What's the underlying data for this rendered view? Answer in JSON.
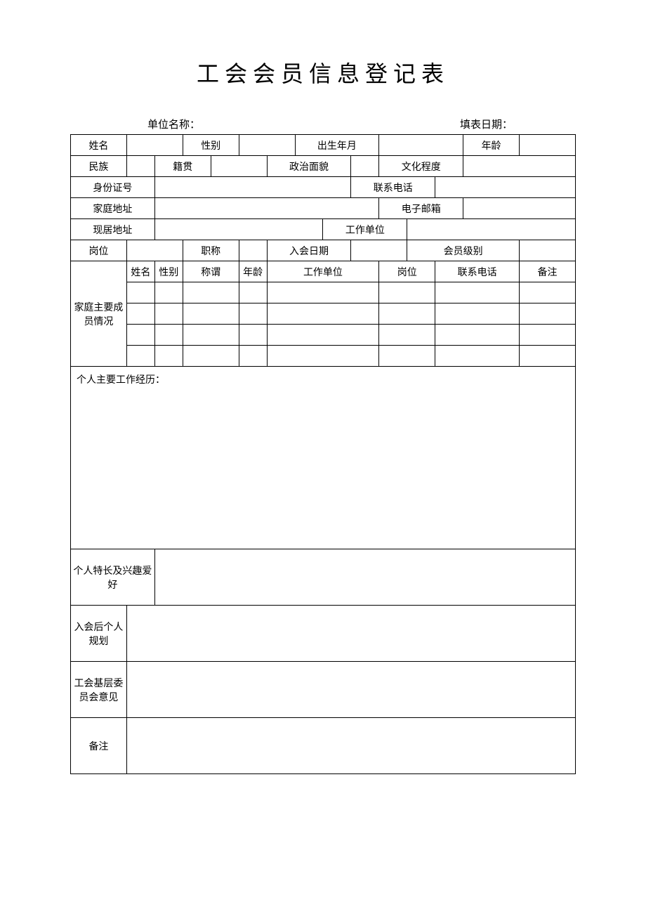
{
  "title": "工会会员信息登记表",
  "header": {
    "unit_label": "单位名称：",
    "date_label": "填表日期："
  },
  "labels": {
    "name": "姓名",
    "gender": "性别",
    "birth": "出生年月",
    "age": "年龄",
    "ethnicity": "民族",
    "native_place": "籍贯",
    "political": "政治面貌",
    "education": "文化程度",
    "id_number": "身份证号",
    "phone": "联系电话",
    "home_address": "家庭地址",
    "email": "电子邮箱",
    "current_address": "现居地址",
    "work_unit": "工作单位",
    "position": "岗位",
    "title_rank": "职称",
    "join_date": "入会日期",
    "member_level": "会员级别",
    "family_section": "家庭主要成员情况",
    "fam_name": "姓名",
    "fam_gender": "性别",
    "fam_relation": "称谓",
    "fam_age": "年龄",
    "fam_work_unit": "工作单位",
    "fam_position": "岗位",
    "fam_phone": "联系电话",
    "fam_remark": "备注",
    "work_history": "个人主要工作经历：",
    "hobbies": "个人特长及兴趣爱好",
    "plan": "入会后个人规划",
    "committee": "工会基层委员会意见",
    "remark": "备注"
  }
}
